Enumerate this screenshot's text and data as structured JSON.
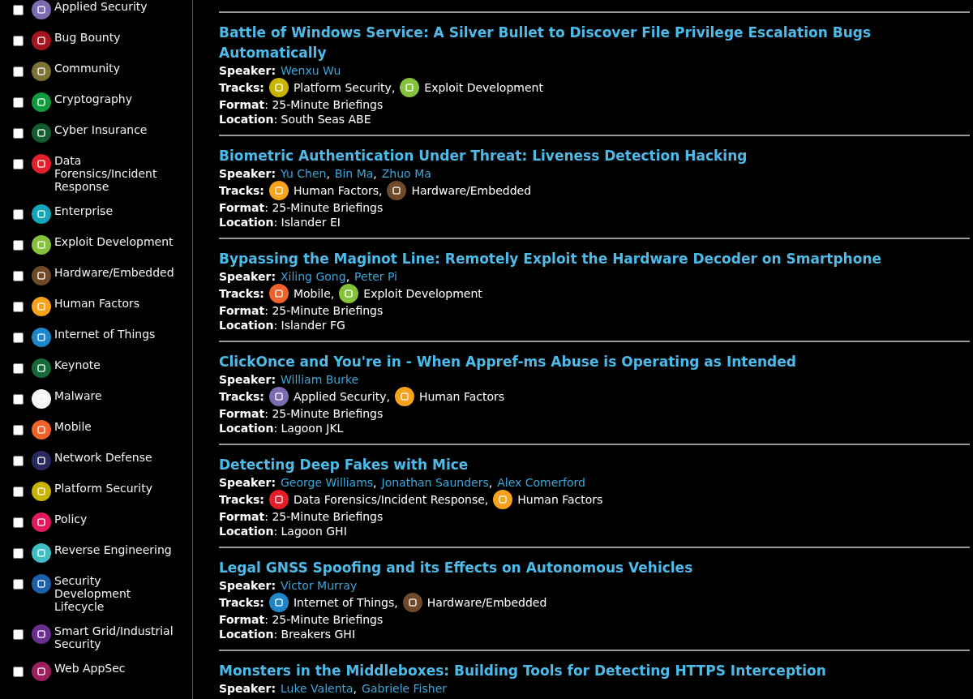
{
  "sidebar": {
    "items": [
      {
        "label": "Applied Security",
        "color": "#7b6bb0",
        "checked": false
      },
      {
        "label": "Bug Bounty",
        "color": "#a3151f",
        "checked": false
      },
      {
        "label": "Community",
        "color": "#7d7235",
        "checked": false
      },
      {
        "label": "Cryptography",
        "color": "#0f9a3e",
        "checked": false
      },
      {
        "label": "Cyber Insurance",
        "color": "#135c2f",
        "checked": false
      },
      {
        "label": "Data Forensics/Incident Response",
        "color": "#e41e2b",
        "checked": false
      },
      {
        "label": "Enterprise",
        "color": "#14a6b8",
        "checked": false
      },
      {
        "label": "Exploit Development",
        "color": "#86c13c",
        "checked": false
      },
      {
        "label": "Hardware/Embedded",
        "color": "#6f4a2a",
        "checked": false
      },
      {
        "label": "Human Factors",
        "color": "#f7a21b",
        "checked": false
      },
      {
        "label": "Internet of Things",
        "color": "#1d86c8",
        "checked": false
      },
      {
        "label": "Keynote",
        "color": "#176b3a",
        "checked": false
      },
      {
        "label": "Malware",
        "color": "#f4f4f4",
        "checked": false
      },
      {
        "label": "Mobile",
        "color": "#f0622a",
        "checked": false
      },
      {
        "label": "Network Defense",
        "color": "#2a2a5e",
        "checked": false
      },
      {
        "label": "Platform Security",
        "color": "#c8b400",
        "checked": false
      },
      {
        "label": "Policy",
        "color": "#e3195f",
        "checked": false
      },
      {
        "label": "Reverse Engineering",
        "color": "#3fbfc4",
        "checked": false
      },
      {
        "label": "Security Development Lifecycle",
        "color": "#1b5fa8",
        "checked": false
      },
      {
        "label": "Smart Grid/Industrial Security",
        "color": "#6a2e91",
        "checked": false
      },
      {
        "label": "Web AppSec",
        "color": "#9b1f5e",
        "checked": false
      }
    ]
  },
  "sessions": [
    {
      "title": "Battle of Windows Service: A Silver Bullet to Discover File Privilege Escalation Bugs Automatically",
      "speaker_label": "Speaker:",
      "speakers": [
        {
          "name": "Wenxu Wu"
        }
      ],
      "tracks_label": "Tracks:",
      "tracks": [
        {
          "name": "Platform Security,",
          "color": "#c8b400"
        },
        {
          "name": "Exploit Development",
          "color": "#86c13c"
        }
      ],
      "format": "**Format**: 25-Minute Briefings",
      "location": "**Location**: South Seas ABE"
    },
    {
      "title": "Biometric Authentication Under Threat: Liveness Detection Hacking",
      "speaker_label": "Speaker:",
      "speakers": [
        {
          "name": "Yu Chen",
          "separator": ","
        },
        {
          "name": "Bin Ma",
          "separator": ","
        },
        {
          "name": "Zhuo Ma"
        }
      ],
      "tracks_label": "Tracks:",
      "tracks": [
        {
          "name": "Human Factors,",
          "color": "#f7a21b"
        },
        {
          "name": "Hardware/Embedded",
          "color": "#6f4a2a"
        }
      ],
      "format": "**Format**: 25-Minute Briefings",
      "location": "**Location**: Islander EI"
    },
    {
      "title": "Bypassing the Maginot Line: Remotely Exploit the Hardware Decoder on Smartphone",
      "speaker_label": "Speaker:",
      "speakers": [
        {
          "name": "Xiling Gong",
          "separator": ","
        },
        {
          "name": "Peter Pi"
        }
      ],
      "tracks_label": "Tracks:",
      "tracks": [
        {
          "name": "Mobile,",
          "color": "#f0622a"
        },
        {
          "name": "Exploit Development",
          "color": "#86c13c"
        }
      ],
      "format": "**Format**: 25-Minute Briefings",
      "location": "**Location**: Islander FG"
    },
    {
      "title": "ClickOnce and You're in - When Appref-ms Abuse is Operating as Intended",
      "speaker_label": "Speaker:",
      "speakers": [
        {
          "name": "William Burke"
        }
      ],
      "tracks_label": "Tracks:",
      "tracks": [
        {
          "name": "Applied Security,",
          "color": "#7b6bb0"
        },
        {
          "name": "Human Factors",
          "color": "#f7a21b"
        }
      ],
      "format": "**Format**: 25-Minute Briefings",
      "location": "**Location**: Lagoon JKL"
    },
    {
      "title": "Detecting Deep Fakes with Mice",
      "speaker_label": "Speaker:",
      "speakers": [
        {
          "name": "George Williams",
          "separator": ","
        },
        {
          "name": "Jonathan Saunders",
          "separator": ","
        },
        {
          "name": "Alex Comerford"
        }
      ],
      "tracks_label": "Tracks:",
      "tracks": [
        {
          "name": "Data Forensics/Incident Response,",
          "color": "#e41e2b"
        },
        {
          "name": "Human Factors",
          "color": "#f7a21b"
        }
      ],
      "format": "**Format**: 25-Minute Briefings",
      "location": "**Location**: Lagoon GHI"
    },
    {
      "title": "Legal GNSS Spoofing and its Effects on Autonomous Vehicles",
      "speaker_label": "Speaker:",
      "speakers": [
        {
          "name": "Victor Murray"
        }
      ],
      "tracks_label": "Tracks:",
      "tracks": [
        {
          "name": "Internet of Things,",
          "color": "#1d86c8"
        },
        {
          "name": "Hardware/Embedded",
          "color": "#6f4a2a"
        }
      ],
      "format": "**Format**: 25-Minute Briefings",
      "location": "**Location**: Breakers GHI"
    },
    {
      "title": "Monsters in the Middleboxes: Building Tools for Detecting HTTPS Interception",
      "speaker_label": "Speaker:",
      "speakers": [
        {
          "name": "Luke Valenta",
          "separator": ","
        },
        {
          "name": "Gabriele Fisher"
        }
      ]
    }
  ]
}
